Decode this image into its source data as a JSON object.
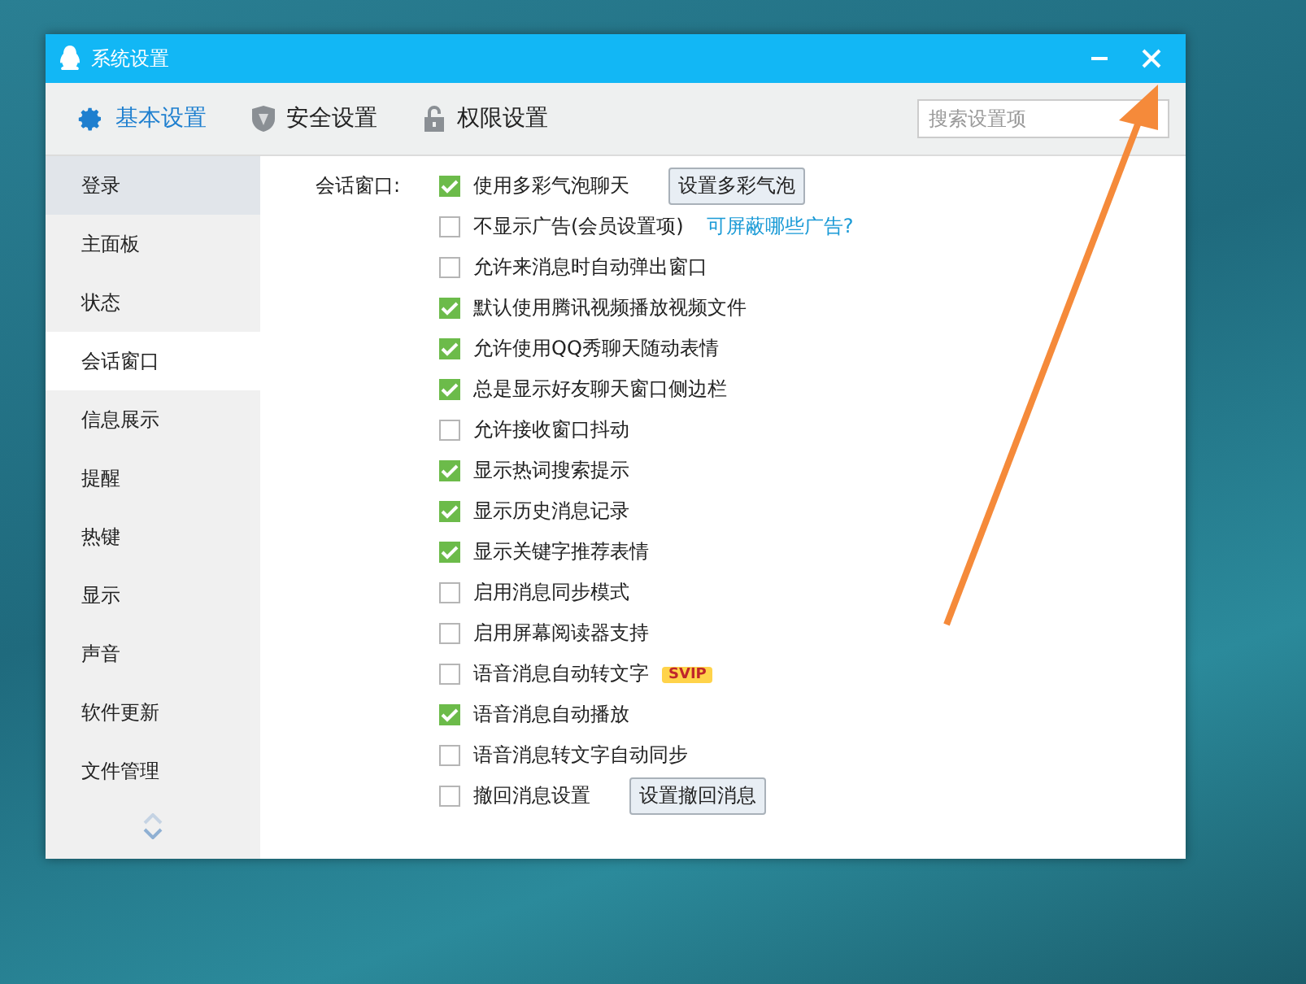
{
  "window": {
    "title": "系统设置"
  },
  "tabs": [
    {
      "label": "基本设置",
      "selected": true,
      "kind": "gear"
    },
    {
      "label": "安全设置",
      "selected": false,
      "kind": "shield"
    },
    {
      "label": "权限设置",
      "selected": false,
      "kind": "lock"
    }
  ],
  "search": {
    "placeholder": "搜索设置项"
  },
  "sidebar": {
    "items": [
      {
        "label": "登录",
        "selected": false,
        "hovered": true
      },
      {
        "label": "主面板",
        "selected": false,
        "hovered": false
      },
      {
        "label": "状态",
        "selected": false,
        "hovered": false
      },
      {
        "label": "会话窗口",
        "selected": true,
        "hovered": false
      },
      {
        "label": "信息展示",
        "selected": false,
        "hovered": false
      },
      {
        "label": "提醒",
        "selected": false,
        "hovered": false
      },
      {
        "label": "热键",
        "selected": false,
        "hovered": false
      },
      {
        "label": "显示",
        "selected": false,
        "hovered": false
      },
      {
        "label": "声音",
        "selected": false,
        "hovered": false
      },
      {
        "label": "软件更新",
        "selected": false,
        "hovered": false
      },
      {
        "label": "文件管理",
        "selected": false,
        "hovered": false
      }
    ]
  },
  "section": {
    "label": "会话窗口:",
    "options": [
      {
        "label": "使用多彩气泡聊天",
        "checked": true,
        "button": "设置多彩气泡"
      },
      {
        "label": "不显示广告(会员设置项)",
        "checked": false,
        "link": "可屏蔽哪些广告?"
      },
      {
        "label": "允许来消息时自动弹出窗口",
        "checked": false
      },
      {
        "label": "默认使用腾讯视频播放视频文件",
        "checked": true
      },
      {
        "label": "允许使用QQ秀聊天随动表情",
        "checked": true
      },
      {
        "label": "总是显示好友聊天窗口侧边栏",
        "checked": true
      },
      {
        "label": "允许接收窗口抖动",
        "checked": false
      },
      {
        "label": "显示热词搜索提示",
        "checked": true
      },
      {
        "label": "显示历史消息记录",
        "checked": true
      },
      {
        "label": "显示关键字推荐表情",
        "checked": true
      },
      {
        "label": "启用消息同步模式",
        "checked": false
      },
      {
        "label": "启用屏幕阅读器支持",
        "checked": false
      },
      {
        "label": "语音消息自动转文字",
        "checked": false,
        "badge": "SVIP"
      },
      {
        "label": "语音消息自动播放",
        "checked": true
      },
      {
        "label": "语音消息转文字自动同步",
        "checked": false
      },
      {
        "label": "撤回消息设置",
        "checked": false,
        "button": "设置撤回消息"
      }
    ]
  }
}
